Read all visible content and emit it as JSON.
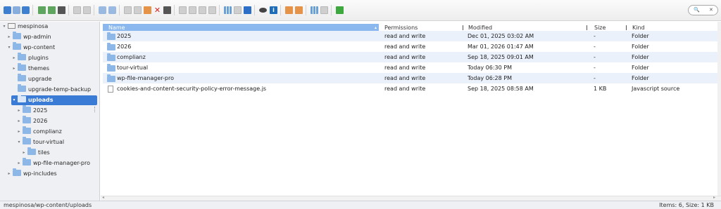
{
  "toolbar": {
    "icons": [
      "back-icon",
      "forward-icon",
      "up-icon",
      "reload-icon",
      "new-file-icon",
      "save-icon",
      "copy-icon",
      "paste-icon",
      "undo-icon",
      "redo-icon",
      "cut-icon",
      "copy-files-icon",
      "paste-files-icon",
      "delete-icon",
      "empty-icon",
      "duplicate-icon",
      "rename-icon",
      "edit-icon",
      "resize-icon",
      "view-icons-icon",
      "view-list-icon",
      "sort-icon",
      "preview-icon",
      "info-icon",
      "extract-icon",
      "archive-icon",
      "grid-icon",
      "help-icon",
      "fullscreen-icon"
    ],
    "search": {
      "placeholder": "",
      "value": ""
    }
  },
  "sidebar": {
    "items": [
      {
        "label": "mespinosa",
        "icon": "drive-icon",
        "toggle": "▾"
      },
      {
        "label": "wp-admin",
        "icon": "folder-icon",
        "toggle": "▸"
      },
      {
        "label": "wp-content",
        "icon": "folder-icon",
        "toggle": "▾"
      },
      {
        "label": "plugins",
        "icon": "folder-icon",
        "toggle": "▸"
      },
      {
        "label": "themes",
        "icon": "folder-icon",
        "toggle": "▸"
      },
      {
        "label": "upgrade",
        "icon": "folder-icon",
        "toggle": ""
      },
      {
        "label": "upgrade-temp-backup",
        "icon": "folder-icon",
        "toggle": ""
      },
      {
        "label": "uploads",
        "icon": "folder-open-icon",
        "toggle": "▾",
        "selected": true
      },
      {
        "label": "2025",
        "icon": "folder-icon",
        "toggle": "▸"
      },
      {
        "label": "2026",
        "icon": "folder-icon",
        "toggle": "▸"
      },
      {
        "label": "complianz",
        "icon": "folder-icon",
        "toggle": "▸"
      },
      {
        "label": "tour-virtual",
        "icon": "folder-icon",
        "toggle": "▾"
      },
      {
        "label": "tiles",
        "icon": "folder-icon",
        "toggle": "▸"
      },
      {
        "label": "wp-file-manager-pro",
        "icon": "folder-icon",
        "toggle": "▸"
      },
      {
        "label": "wp-includes",
        "icon": "folder-icon",
        "toggle": "▸"
      }
    ]
  },
  "files": {
    "columns": {
      "name": "Name",
      "permissions": "Permissions",
      "modified": "Modified",
      "size": "Size",
      "kind": "Kind"
    },
    "rows": [
      {
        "name": "2025",
        "permissions": "read and write",
        "modified": "Dec 01, 2025 03:02 AM",
        "size": "-",
        "kind": "Folder",
        "icon": "folder-icon"
      },
      {
        "name": "2026",
        "permissions": "read and write",
        "modified": "Mar 01, 2026 01:47 AM",
        "size": "-",
        "kind": "Folder",
        "icon": "folder-icon"
      },
      {
        "name": "complianz",
        "permissions": "read and write",
        "modified": "Sep 18, 2025 09:01 AM",
        "size": "-",
        "kind": "Folder",
        "icon": "folder-icon"
      },
      {
        "name": "tour-virtual",
        "permissions": "read and write",
        "modified": "Today 06:30 PM",
        "size": "-",
        "kind": "Folder",
        "icon": "folder-icon"
      },
      {
        "name": "wp-file-manager-pro",
        "permissions": "read and write",
        "modified": "Today 06:28 PM",
        "size": "-",
        "kind": "Folder",
        "icon": "folder-icon"
      },
      {
        "name": "cookies-and-content-security-policy-error-message.js",
        "permissions": "read and write",
        "modified": "Sep 18, 2025 08:58 AM",
        "size": "1 KB",
        "kind": "Javascript source",
        "icon": "js-file-icon"
      }
    ]
  },
  "status": {
    "path": "mespinosa/wp-content/uploads",
    "info": "Items: 6, Size: 1 KB"
  },
  "colors": {
    "selected": "#3a7bd5",
    "header": "#8ab8ee",
    "alt_row": "#eaf1fb"
  }
}
